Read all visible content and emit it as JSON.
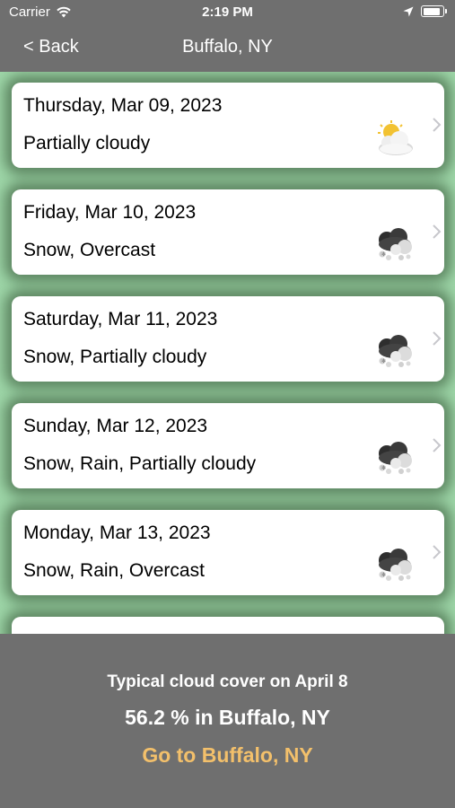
{
  "status_bar": {
    "carrier": "Carrier",
    "time": "2:19 PM",
    "icons": [
      "wifi-icon",
      "location-arrow-icon",
      "battery-icon"
    ]
  },
  "nav": {
    "back_label": "< Back",
    "title": "Buffalo, NY"
  },
  "colors": {
    "bars": "#6f6f6f",
    "list_background": "#9ed6a8",
    "link": "#f3c06b"
  },
  "forecast": [
    {
      "date": "Thursday, Mar 09, 2023",
      "conditions": "Partially cloudy",
      "icon": "partly-cloudy-icon"
    },
    {
      "date": "Friday, Mar 10, 2023",
      "conditions": "Snow, Overcast",
      "icon": "snow-cloud-icon"
    },
    {
      "date": "Saturday, Mar 11, 2023",
      "conditions": "Snow, Partially cloudy",
      "icon": "snow-cloud-icon"
    },
    {
      "date": "Sunday, Mar 12, 2023",
      "conditions": "Snow, Rain, Partially cloudy",
      "icon": "snow-cloud-icon"
    },
    {
      "date": "Monday, Mar 13, 2023",
      "conditions": "Snow, Rain, Overcast",
      "icon": "snow-cloud-icon"
    }
  ],
  "bottom": {
    "typical_label": "Typical cloud cover on April 8",
    "cover_value": "56.2 % in Buffalo, NY",
    "goto_label": "Go to Buffalo, NY"
  }
}
